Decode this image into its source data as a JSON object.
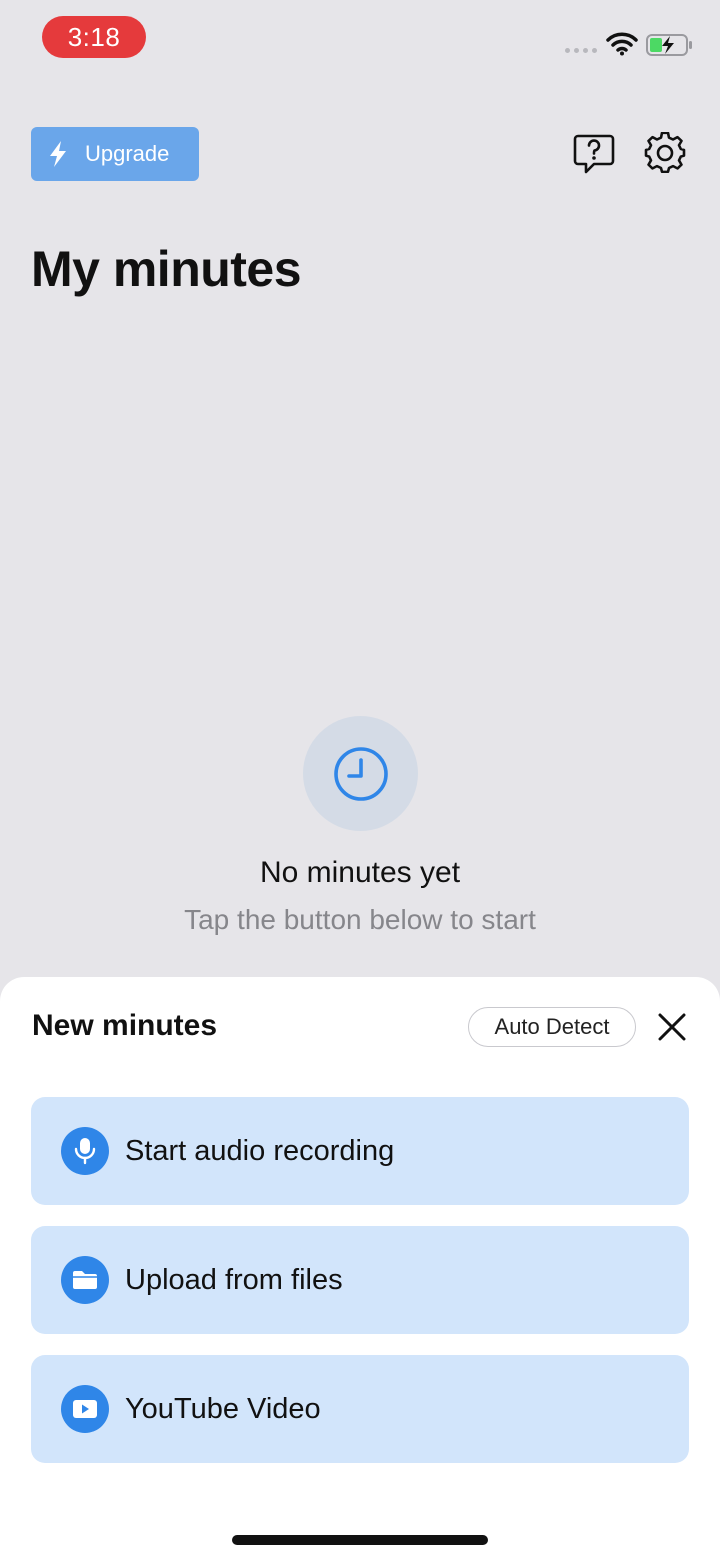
{
  "status_bar": {
    "time": "3:18"
  },
  "header": {
    "upgrade_label": "Upgrade",
    "help_icon": "help-bubble-icon",
    "settings_icon": "gear-icon",
    "title": "My minutes"
  },
  "empty_state": {
    "icon": "clock-icon",
    "title": "No minutes yet",
    "subtitle": "Tap the button below to start"
  },
  "sheet": {
    "title": "New minutes",
    "language_chip": "Auto Detect",
    "options": [
      {
        "label": "Start audio recording",
        "icon": "microphone-icon"
      },
      {
        "label": "Upload from files",
        "icon": "folder-icon"
      },
      {
        "label": "YouTube Video",
        "icon": "play-icon"
      }
    ]
  },
  "colors": {
    "background": "#e6e5e9",
    "accent": "#2f86e8",
    "upgrade": "#6aa6ea",
    "option_bg": "#d2e5fb",
    "time_pill": "#e53a3c",
    "battery_green": "#4cd964"
  }
}
